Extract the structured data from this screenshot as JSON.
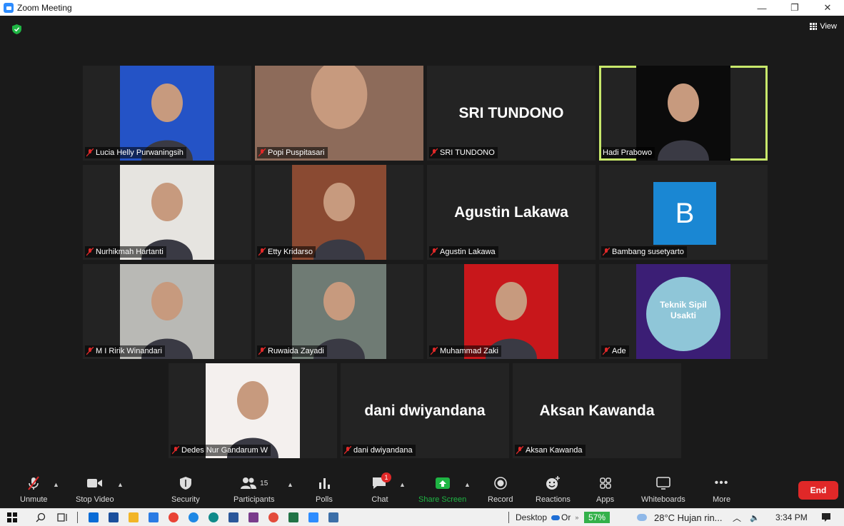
{
  "window": {
    "title": "Zoom Meeting",
    "controls": [
      "—",
      "❐",
      "✕"
    ]
  },
  "header": {
    "view_label": "View"
  },
  "tiles": [
    {
      "name": "Lucia Helly Purwaningsih",
      "mode": "video",
      "bg": "#2453c6",
      "muted": true
    },
    {
      "name": "Popi Puspitasari",
      "mode": "video",
      "bg": "#8d6b5a",
      "muted": true
    },
    {
      "name": "SRI TUNDONO",
      "mode": "text",
      "muted": true
    },
    {
      "name": "Hadi Prabowo",
      "mode": "video",
      "bg": "#0b0b0b",
      "muted": false,
      "active": true
    },
    {
      "name": "Nurhikmah Hartanti",
      "mode": "video",
      "bg": "#e6e4e0",
      "muted": true
    },
    {
      "name": "Etty Kridarso",
      "mode": "video",
      "bg": "#8a4a32",
      "muted": true
    },
    {
      "name": "Agustin Lakawa",
      "mode": "text",
      "muted": true
    },
    {
      "name": "Bambang susetyarto",
      "mode": "avatar",
      "avatar_letter": "B",
      "muted": true
    },
    {
      "name": "M I Ririk Winandari",
      "mode": "video",
      "bg": "#b9b9b5",
      "muted": true
    },
    {
      "name": "Ruwaida Zayadi",
      "mode": "video",
      "bg": "#6f7b74",
      "muted": true
    },
    {
      "name": "Muhammad Zaki",
      "mode": "video",
      "bg": "#c8171b",
      "muted": true
    },
    {
      "name": "Ade",
      "mode": "logo",
      "logo_text": [
        "Teknik Sipil",
        "Usakti"
      ],
      "bg": "#3b1e75",
      "muted": true
    },
    {
      "name": "Dedes Nur Gandarum W",
      "mode": "video",
      "bg": "#f4f0ee",
      "muted": true
    },
    {
      "name": "dani dwiyandana",
      "mode": "text",
      "muted": true
    },
    {
      "name": "Aksan Kawanda",
      "mode": "text",
      "muted": true
    }
  ],
  "toolbar": {
    "unmute": "Unmute",
    "stop_video": "Stop Video",
    "security": "Security",
    "participants": "Participants",
    "participants_count": "15",
    "polls": "Polls",
    "chat": "Chat",
    "chat_badge": "1",
    "share_screen": "Share Screen",
    "record": "Record",
    "reactions": "Reactions",
    "apps": "Apps",
    "whiteboards": "Whiteboards",
    "more": "More",
    "end": "End"
  },
  "taskbar": {
    "desktop": "Desktop",
    "onedrive": "Or",
    "battery": "57%",
    "weather": "28°C  Hujan rin...",
    "time": "3:34 PM"
  },
  "colors": {
    "accent_green": "#c8e86b",
    "end_red": "#e02828",
    "share_green": "#1fb544",
    "zoom_blue": "#2d8cff"
  }
}
